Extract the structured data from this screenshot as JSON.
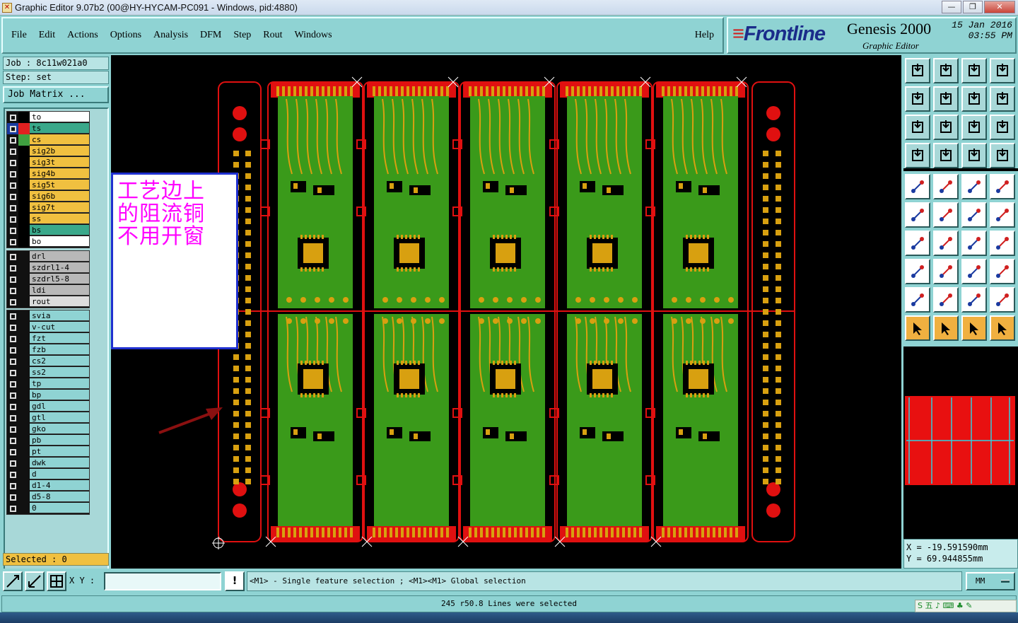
{
  "window": {
    "title": "Graphic Editor 9.07b2 (00@HY-HYCAM-PC091 - Windows, pid:4880)",
    "minimize": "—",
    "maximize": "❐",
    "close": "✕"
  },
  "menu": {
    "items": [
      "File",
      "Edit",
      "Actions",
      "Options",
      "Analysis",
      "DFM",
      "Step",
      "Rout",
      "Windows"
    ],
    "help": "Help"
  },
  "logo": {
    "brand": "Frontline",
    "product": "Genesis 2000",
    "subtitle": "Graphic Editor",
    "date": "15 Jan 2016",
    "time": "03:55 PM"
  },
  "job": {
    "job_line": "Job : 8c11w021a0",
    "step_line": "Step: set",
    "matrix_button": "Job Matrix ..."
  },
  "layers": {
    "board": [
      {
        "name": "to",
        "color": "#ffffff",
        "swatch": "#000000"
      },
      {
        "name": "ts",
        "color": "#3aa88a",
        "swatch": "#e02020",
        "active": true
      },
      {
        "name": "cs",
        "color": "#f0c040",
        "swatch": "#40a040"
      },
      {
        "name": "sig2b",
        "color": "#f0c040",
        "swatch": "#000000"
      },
      {
        "name": "sig3t",
        "color": "#f0c040",
        "swatch": "#000000"
      },
      {
        "name": "sig4b",
        "color": "#f0c040",
        "swatch": "#000000"
      },
      {
        "name": "sig5t",
        "color": "#f0c040",
        "swatch": "#000000"
      },
      {
        "name": "sig6b",
        "color": "#f0c040",
        "swatch": "#000000"
      },
      {
        "name": "sig7t",
        "color": "#f0c040",
        "swatch": "#000000"
      },
      {
        "name": "ss",
        "color": "#f0c040",
        "swatch": "#000000"
      },
      {
        "name": "bs",
        "color": "#3aa88a",
        "swatch": "#000000"
      },
      {
        "name": "bo",
        "color": "#ffffff",
        "swatch": "#000000"
      }
    ],
    "drill": [
      {
        "name": "drl",
        "color": "#b8b8b8"
      },
      {
        "name": "szdrl1-4",
        "color": "#b8b8b8"
      },
      {
        "name": "szdrl5-8",
        "color": "#b8b8b8"
      },
      {
        "name": "ldi",
        "color": "#b8b8b8"
      },
      {
        "name": "rout",
        "color": "#dcdcdc"
      }
    ],
    "misc": [
      {
        "name": "svia",
        "color": "#8fd3d3"
      },
      {
        "name": "v-cut",
        "color": "#8fd3d3"
      },
      {
        "name": "fzt",
        "color": "#8fd3d3"
      },
      {
        "name": "fzb",
        "color": "#8fd3d3"
      },
      {
        "name": "cs2",
        "color": "#8fd3d3"
      },
      {
        "name": "ss2",
        "color": "#8fd3d3"
      },
      {
        "name": "tp",
        "color": "#8fd3d3"
      },
      {
        "name": "bp",
        "color": "#8fd3d3"
      },
      {
        "name": "gdl",
        "color": "#8fd3d3"
      },
      {
        "name": "gtl",
        "color": "#8fd3d3"
      },
      {
        "name": "gko",
        "color": "#8fd3d3"
      },
      {
        "name": "pb",
        "color": "#8fd3d3"
      },
      {
        "name": "pt",
        "color": "#8fd3d3"
      },
      {
        "name": "dwk",
        "color": "#8fd3d3"
      },
      {
        "name": "d",
        "color": "#8fd3d3"
      },
      {
        "name": "d1-4",
        "color": "#8fd3d3"
      },
      {
        "name": "d5-8",
        "color": "#8fd3d3"
      },
      {
        "name": "0",
        "color": "#8fd3d3"
      }
    ]
  },
  "selected": "Selected : 0",
  "annotation": {
    "lines": [
      "工艺边上",
      "的阻流铜",
      "不用开窗"
    ]
  },
  "coords": {
    "x": "X = -19.591590mm",
    "y": "Y = 69.944855mm"
  },
  "bottom": {
    "xy_label": "X Y :",
    "xy_value": "",
    "warn": "!",
    "hint": "<M1> - Single feature selection ; <M1><M1> Global selection",
    "units": "MM"
  },
  "status": "245 r50.8 Lines were selected",
  "ime": "S 五 ♪ ⌨ ♣ ✎",
  "colors": {
    "board_green": "#3a9a1a",
    "copper_red": "#e01010",
    "pad_yellow": "#d8a010",
    "canvas_bg": "#000000",
    "panel_bg": "#8fd3d3"
  }
}
